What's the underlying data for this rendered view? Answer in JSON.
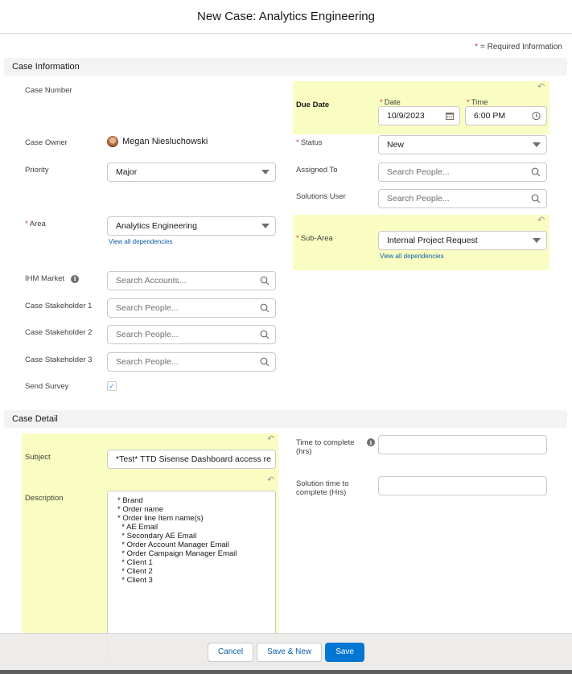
{
  "header": {
    "title": "New Case: Analytics Engineering"
  },
  "required_info": {
    "star": "*",
    "text": "= Required Information"
  },
  "sections": {
    "case_information": "Case Information",
    "case_detail": "Case Detail"
  },
  "case_info": {
    "case_number": {
      "label": "Case Number",
      "value": ""
    },
    "case_owner": {
      "label": "Case Owner",
      "value": "Megan Niesluchowski"
    },
    "priority": {
      "label": "Priority",
      "value": "Major"
    },
    "area": {
      "label": "Area",
      "required": "*",
      "value": "Analytics Engineering",
      "link": "View all dependencies"
    },
    "ihm_market": {
      "label": "IHM Market",
      "placeholder": "Search Accounts..."
    },
    "stakeholder_1": {
      "label": "Case Stakeholder 1",
      "placeholder": "Search People..."
    },
    "stakeholder_2": {
      "label": "Case Stakeholder 2",
      "placeholder": "Search People..."
    },
    "stakeholder_3": {
      "label": "Case Stakeholder 3",
      "placeholder": "Search People..."
    },
    "send_survey": {
      "label": "Send Survey",
      "checked": true,
      "check_glyph": "✓"
    },
    "due_date": {
      "label": "Due Date",
      "date_label": "Date",
      "date_value": "10/9/2023",
      "time_label": "Time",
      "time_value": "6:00 PM",
      "required": "*"
    },
    "status": {
      "label": "Status",
      "required": "*",
      "value": "New"
    },
    "assigned_to": {
      "label": "Assigned To",
      "placeholder": "Search People..."
    },
    "solutions_user": {
      "label": "Solutions User",
      "placeholder": "Search People..."
    },
    "sub_area": {
      "label": "Sub-Area",
      "required": "*",
      "value": "Internal Project Request",
      "link": "View all dependencies"
    }
  },
  "case_detail": {
    "subject": {
      "label": "Subject",
      "value": "*Test* TTD Sisense Dashboard access re"
    },
    "description": {
      "label": "Description",
      "lines": [
        "* Brand",
        "* Order name",
        "* Order line Item name(s)",
        "  * AE Email",
        "  * Secondary AE Email",
        "  * Order Account Manager Email",
        "  * Order Campaign Manager Email",
        "  * Client 1",
        "  * Client 2",
        "  * Client 3"
      ]
    },
    "time_to_complete": {
      "label": "Time to complete (hrs)",
      "value": ""
    },
    "solution_time": {
      "label": "Solution time to complete (Hrs)",
      "value": ""
    }
  },
  "icons": {
    "undo": "↶",
    "info": "i"
  },
  "footer": {
    "cancel": "Cancel",
    "save_new": "Save & New",
    "save": "Save"
  },
  "colors": {
    "accent": "#0176d3",
    "link": "#0b5cab",
    "required": "#c23934",
    "highlight": "#fafdc1"
  }
}
